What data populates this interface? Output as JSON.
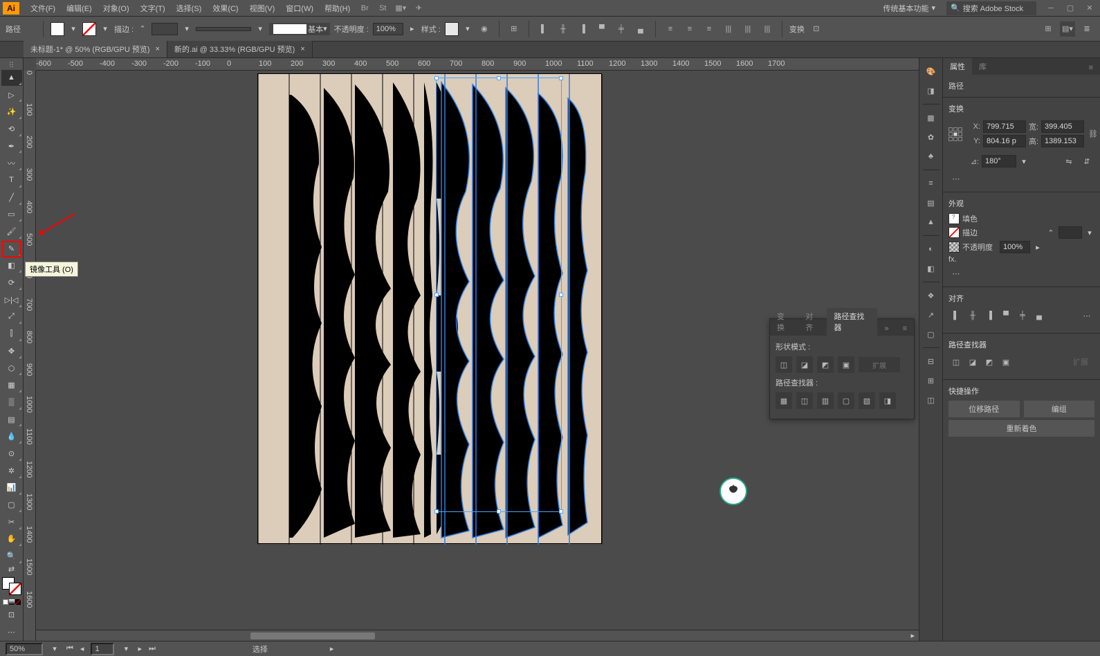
{
  "menubar": {
    "logo": "Ai",
    "items": [
      "文件(F)",
      "编辑(E)",
      "对象(O)",
      "文字(T)",
      "选择(S)",
      "效果(C)",
      "视图(V)",
      "窗口(W)",
      "帮助(H)"
    ],
    "workspace": "传统基本功能",
    "search_placeholder": "搜索 Adobe Stock"
  },
  "optbar": {
    "sel_kind": "路径",
    "stroke_label": "描边 :",
    "stroke_profile": "基本",
    "opacity_label": "不透明度 :",
    "opacity_value": "100%",
    "style_label": "样式 :",
    "transform_label": "变换"
  },
  "tabs": [
    {
      "title": "未标题-1* @ 50% (RGB/GPU 预览)",
      "active": true
    },
    {
      "title": "新的.ai @ 33.33% (RGB/GPU 预览)",
      "active": false
    }
  ],
  "tooltip": "镜像工具 (O)",
  "rulers": {
    "h": [
      "-600",
      "-500",
      "-400",
      "-300",
      "-200",
      "-100",
      "0",
      "100",
      "200",
      "300",
      "400",
      "500",
      "600",
      "700",
      "800",
      "900",
      "1000",
      "1100",
      "1200",
      "1300",
      "1400",
      "1500",
      "1600",
      "1700"
    ],
    "v": [
      "0",
      "100",
      "200",
      "300",
      "400",
      "500",
      "600",
      "700",
      "800",
      "900",
      "1000",
      "1100",
      "1200",
      "1300",
      "1400",
      "1500",
      "1600"
    ]
  },
  "float_panel": {
    "tabs": [
      "变换",
      "对齐",
      "路径查找器"
    ],
    "shape_modes": "形状模式 :",
    "pathfinders": "路径查找器 :",
    "expand": "扩展"
  },
  "props": {
    "tabs": [
      "属性",
      "库"
    ],
    "kind": "路径",
    "transform": {
      "title": "变换",
      "x_label": "X:",
      "x": "799.715",
      "y_label": "Y:",
      "y": "804.16 p",
      "w_label": "宽:",
      "w": "399.405",
      "h_label": "高:",
      "h": "1389.153",
      "angle_label": "⊿:",
      "angle": "180°"
    },
    "appearance": {
      "title": "外观",
      "fill": "填色",
      "stroke": "描边",
      "opacity_label": "不透明度",
      "opacity": "100%",
      "fx": "fx."
    },
    "align_title": "对齐",
    "pathfinder_title": "路径查找器",
    "quick_title": "快捷操作",
    "quick": [
      "位移路径",
      "编组",
      "重新着色"
    ]
  },
  "status": {
    "zoom": "50%",
    "artboard": "1",
    "mode": "选择"
  }
}
